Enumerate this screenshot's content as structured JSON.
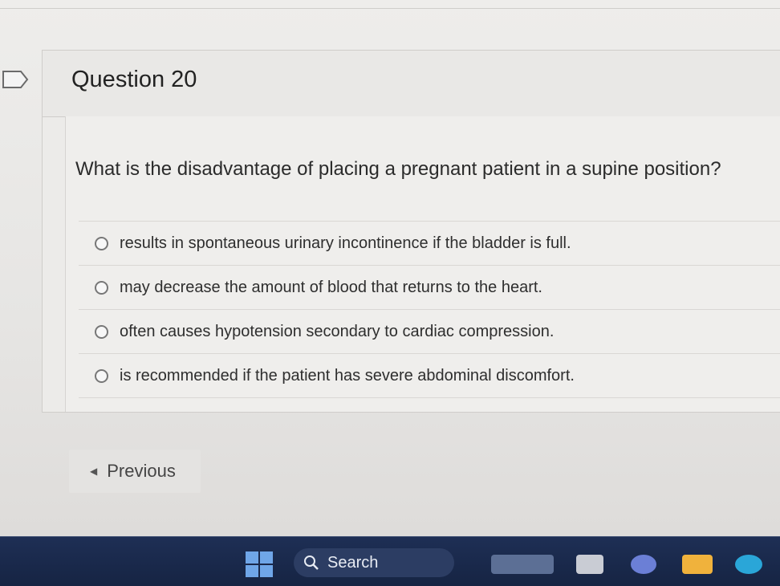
{
  "question": {
    "title": "Question 20",
    "text": "What is the disadvantage of placing a pregnant patient in a supine position?",
    "options": [
      "results in spontaneous urinary incontinence if the bladder is full.",
      "may decrease the amount of blood that returns to the heart.",
      "often causes hypotension secondary to cardiac compression.",
      "is recommended if the patient has severe abdominal discomfort."
    ]
  },
  "navigation": {
    "previous_label": "Previous"
  },
  "taskbar": {
    "search_label": "Search",
    "icons": [
      "start-icon",
      "search-icon",
      "widgets-icon",
      "task-view-icon",
      "copilot-icon",
      "file-explorer-icon",
      "edge-icon"
    ]
  },
  "colors": {
    "taskbar": "#1e2f55",
    "page_background": "#eeedeb"
  }
}
